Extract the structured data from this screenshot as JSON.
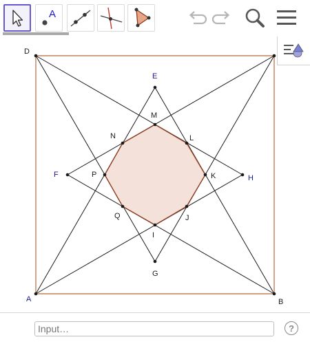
{
  "toolbar": {
    "tools": [
      {
        "name": "move-tool",
        "selected": true
      },
      {
        "name": "point-tool",
        "selected": false,
        "glyph": "A"
      },
      {
        "name": "line-tool",
        "selected": false
      },
      {
        "name": "perpendicular-line-tool",
        "selected": false
      },
      {
        "name": "polygon-tool",
        "selected": false
      }
    ],
    "right_icons": [
      "undo-icon",
      "redo-icon",
      "search-icon",
      "menu-icon"
    ]
  },
  "side_panel": {
    "icon": "style-bar-toggle-icon"
  },
  "input_bar": {
    "placeholder": "Input…",
    "help": "?"
  },
  "colors": {
    "square": "#c0805a",
    "octagon_stroke": "#8b3a1f",
    "octagon_fill": "#f3e1da",
    "point_dark": "#1a1a1a",
    "point_blue": "#1a1a8c",
    "selected_tool": "#6557d2"
  },
  "points": {
    "A": "A",
    "B": "B",
    "D": "D",
    "E": "E",
    "F": "F",
    "G": "G",
    "H": "H",
    "I": "I",
    "J": "J",
    "K": "K",
    "L": "L",
    "M": "M",
    "N": "N",
    "P": "P",
    "Q": "Q"
  }
}
